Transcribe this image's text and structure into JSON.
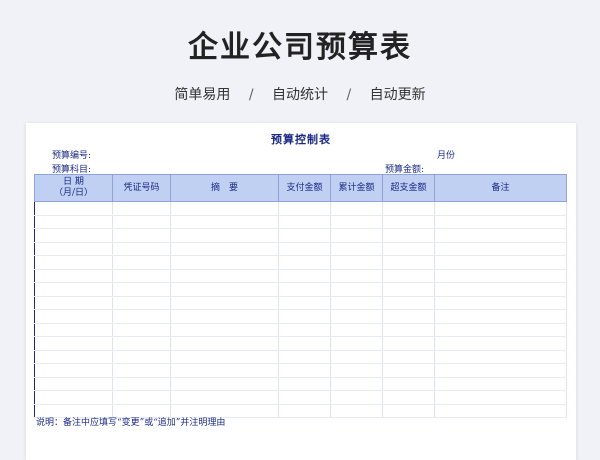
{
  "header": {
    "title": "企业公司预算表",
    "tags": [
      "简单易用",
      "自动统计",
      "自动更新"
    ],
    "separator": "/"
  },
  "sheet": {
    "title": "预算控制表",
    "budget_code_label": "预算编号:",
    "month_label": "月份",
    "budget_subject_label": "预算科目:",
    "budget_amount_label": "预算金额:",
    "columns": {
      "date_line1": "日 期",
      "date_line2": "（月/日）",
      "voucher": "凭证号码",
      "summary": "摘　要",
      "payment": "支付金额",
      "cumulative": "累计金额",
      "overspend": "超支金额",
      "remarks": "备注"
    },
    "note": "说明：备注中应填写“变更”或“追加”并注明理由"
  },
  "colors": {
    "header_fill": "#bfd0f2",
    "text_blue": "#1b2a86",
    "background": "#f1f2f7"
  }
}
